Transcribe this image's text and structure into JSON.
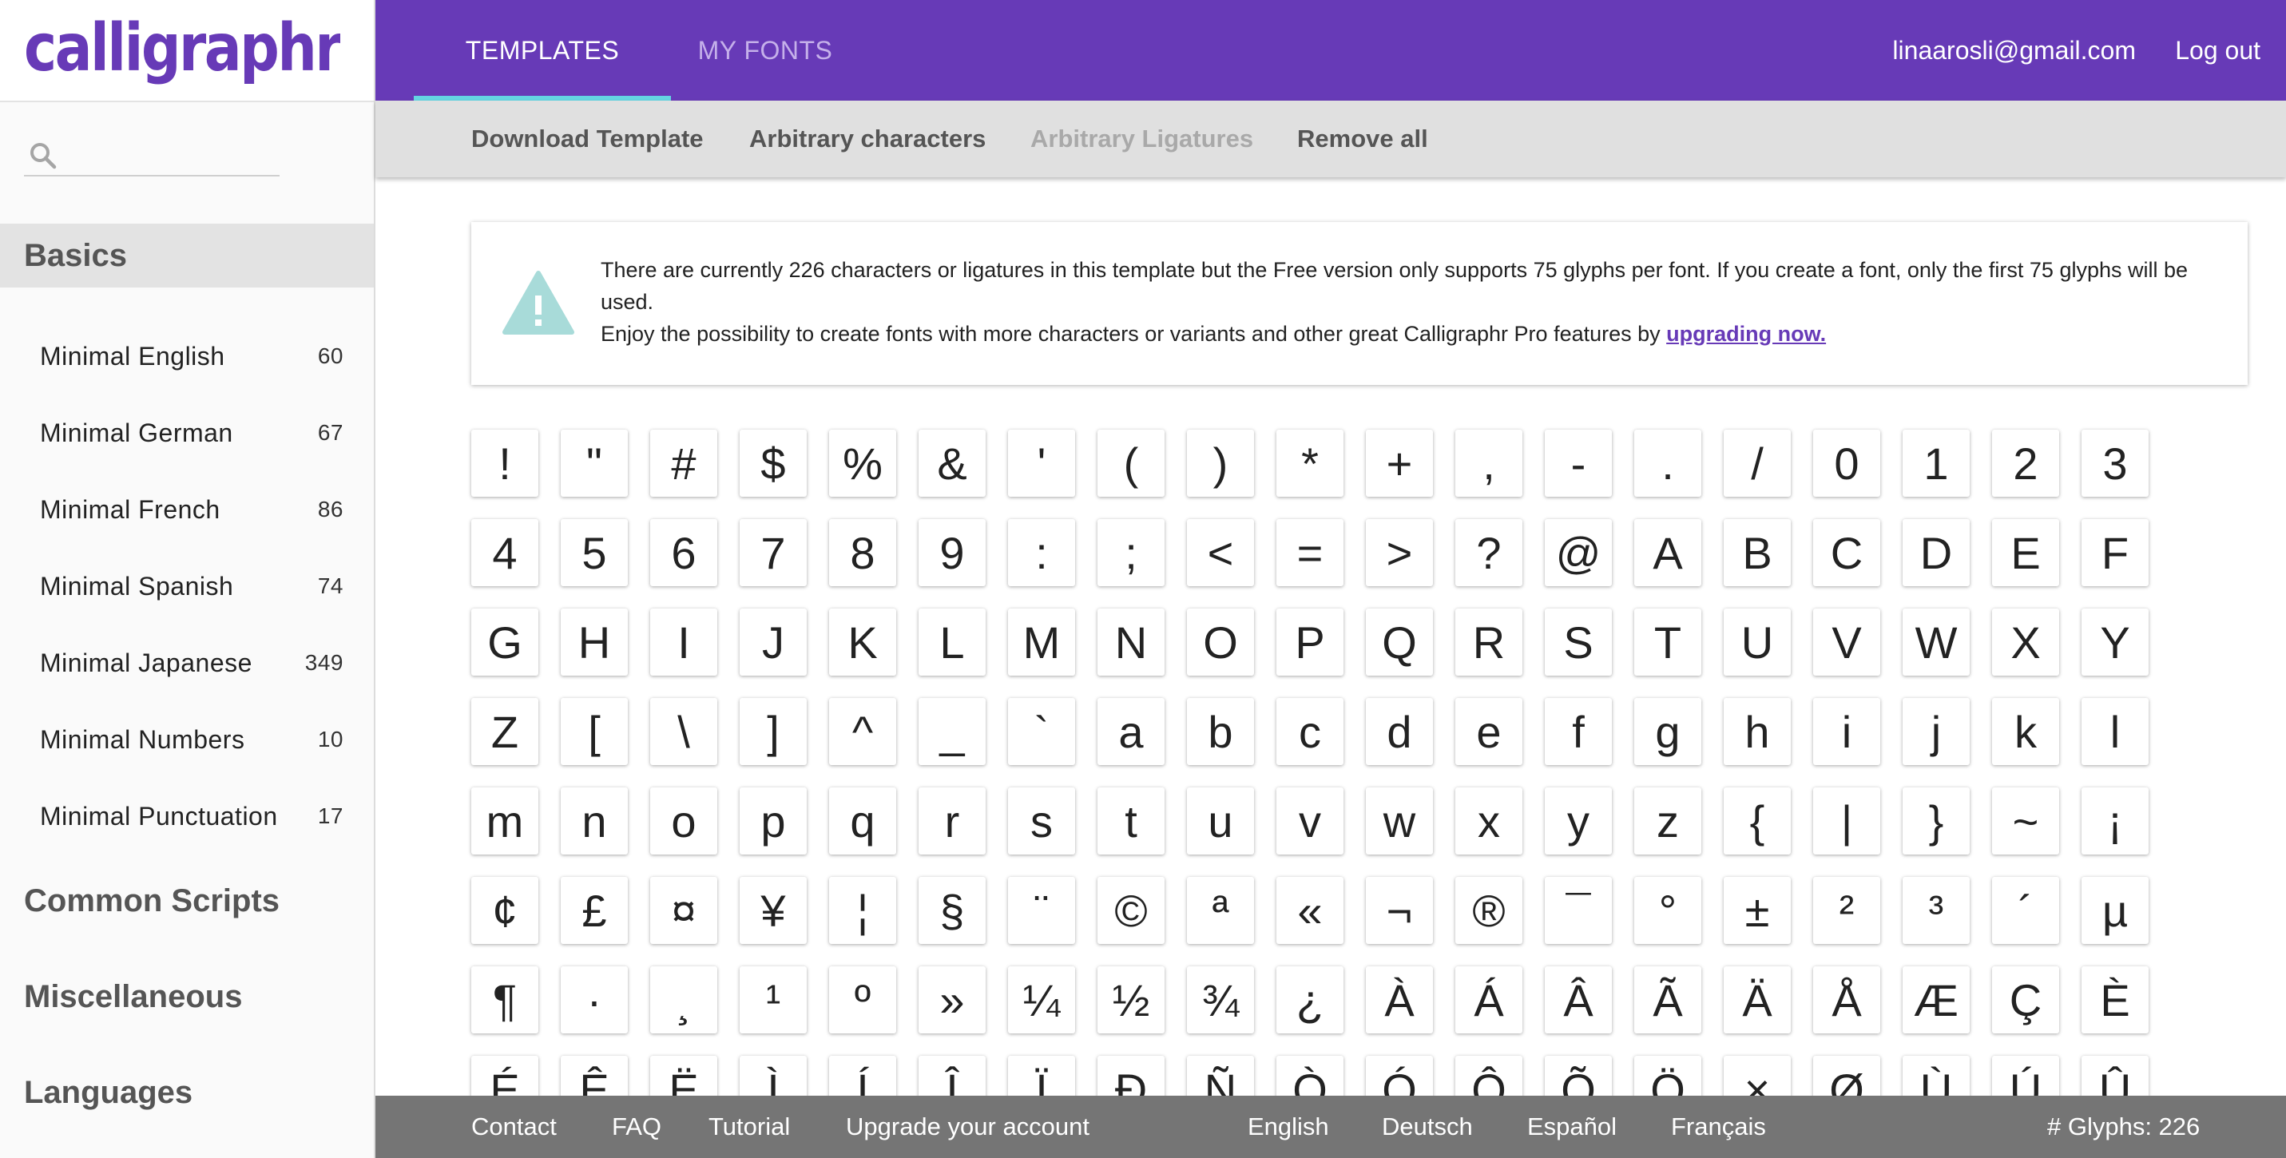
{
  "brand": {
    "logo_text": "calligraphr",
    "color": "#673ab7"
  },
  "sidebar": {
    "search": {
      "placeholder": "",
      "value": ""
    },
    "categories": {
      "basics": "Basics",
      "common_scripts": "Common Scripts",
      "miscellaneous": "Miscellaneous",
      "languages": "Languages"
    },
    "items": [
      {
        "label": "Minimal English",
        "count": "60"
      },
      {
        "label": "Minimal German",
        "count": "67"
      },
      {
        "label": "Minimal French",
        "count": "86"
      },
      {
        "label": "Minimal Spanish",
        "count": "74"
      },
      {
        "label": "Minimal Japanese",
        "count": "349"
      },
      {
        "label": "Minimal Numbers",
        "count": "10"
      },
      {
        "label": "Minimal Punctuation",
        "count": "17"
      }
    ]
  },
  "topnav": {
    "tabs": [
      {
        "label": "TEMPLATES",
        "active": true
      },
      {
        "label": "MY FONTS",
        "active": false
      }
    ],
    "user_email": "linaarosli@gmail.com",
    "logout": "Log out",
    "accent_underline": "#64d4e2"
  },
  "toolbar": {
    "download_template": "Download Template",
    "arbitrary_characters": "Arbitrary characters",
    "arbitrary_ligatures": "Arbitrary Ligatures",
    "remove_all": "Remove all"
  },
  "notice": {
    "line1": "There are currently 226 characters or ligatures in this template but the Free version only supports 75 glyphs per font. If you create a font, only the first 75 glyphs will be used.",
    "line2_prefix": "Enjoy the possibility to create fonts with more characters or variants and other great Calligraphr Pro features by ",
    "link": "upgrading now.",
    "icon": "warning-triangle-icon",
    "icon_color": "#a8dbd9"
  },
  "glyphs": [
    "!",
    "\"",
    "#",
    "$",
    "%",
    "&",
    "'",
    "(",
    ")",
    "*",
    "+",
    ",",
    "-",
    ".",
    "/",
    "0",
    "1",
    "2",
    "3",
    "4",
    "5",
    "6",
    "7",
    "8",
    "9",
    ":",
    ";",
    "<",
    "=",
    ">",
    "?",
    "@",
    "A",
    "B",
    "C",
    "D",
    "E",
    "F",
    "G",
    "H",
    "I",
    "J",
    "K",
    "L",
    "M",
    "N",
    "O",
    "P",
    "Q",
    "R",
    "S",
    "T",
    "U",
    "V",
    "W",
    "X",
    "Y",
    "Z",
    "[",
    "\\",
    "]",
    "^",
    "_",
    "`",
    "a",
    "b",
    "c",
    "d",
    "e",
    "f",
    "g",
    "h",
    "i",
    "j",
    "k",
    "l",
    "m",
    "n",
    "o",
    "p",
    "q",
    "r",
    "s",
    "t",
    "u",
    "v",
    "w",
    "x",
    "y",
    "z",
    "{",
    "|",
    "}",
    "~",
    "¡",
    "¢",
    "£",
    "¤",
    "¥",
    "¦",
    "§",
    "¨",
    "©",
    "ª",
    "«",
    "¬",
    "®",
    "¯",
    "°",
    "±",
    "²",
    "³",
    "´",
    "µ",
    "¶",
    "·",
    "¸",
    "¹",
    "º",
    "»",
    "¼",
    "½",
    "¾",
    "¿",
    "À",
    "Á",
    "Â",
    "Ã",
    "Ä",
    "Å",
    "Æ",
    "Ç",
    "È",
    "É",
    "Ê",
    "Ë",
    "Ì",
    "Í",
    "Î",
    "Ï",
    "Ð",
    "Ñ",
    "Ò",
    "Ó",
    "Ô",
    "Õ",
    "Ö",
    "×",
    "Ø",
    "Ù",
    "Ú",
    "Û"
  ],
  "footer": {
    "links": [
      "Contact",
      "FAQ",
      "Tutorial",
      "Upgrade your account"
    ],
    "languages": [
      "English",
      "Deutsch",
      "Español",
      "Français"
    ],
    "glyph_count": "# Glyphs: 226"
  }
}
